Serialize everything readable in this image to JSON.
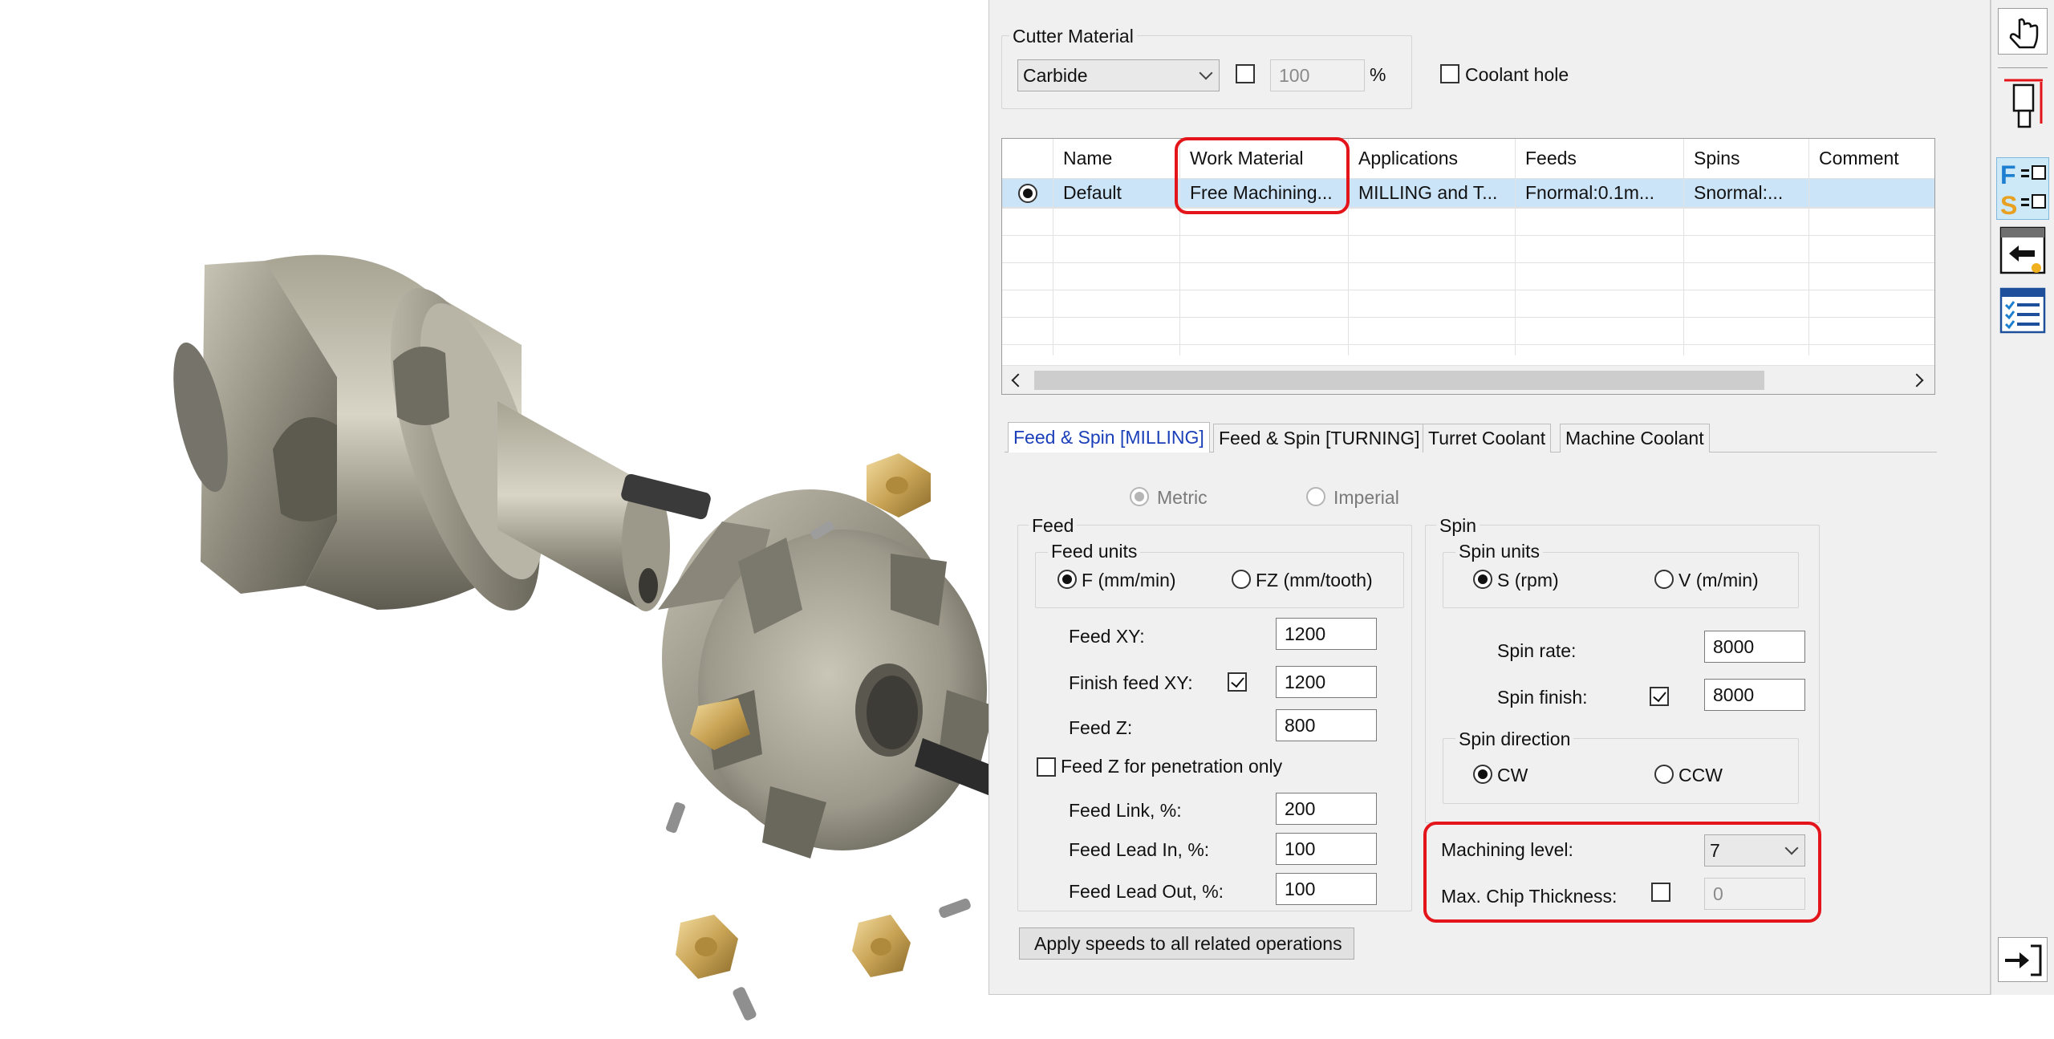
{
  "cutter_material": {
    "group_label": "Cutter Material",
    "material": "Carbide",
    "percent_value": "100",
    "percent_unit": "%",
    "coolant_hole_label": "Coolant hole"
  },
  "table": {
    "columns": [
      "Name",
      "Work Material",
      "Applications",
      "Feeds",
      "Spins",
      "Comment"
    ],
    "rows": [
      {
        "name": "Default",
        "work_material": "Free Machining...",
        "applications": "MILLING and T...",
        "feeds": "Fnormal:0.1m...",
        "spins": "Snormal:...",
        "comment": ""
      }
    ]
  },
  "tabs": [
    "Feed & Spin [MILLING]",
    "Feed & Spin [TURNING]",
    "Turret Coolant",
    "Machine Coolant"
  ],
  "units": {
    "metric": "Metric",
    "imperial": "Imperial"
  },
  "feed": {
    "group_label": "Feed",
    "units_label": "Feed units",
    "unit_f": "F (mm/min)",
    "unit_fz": "FZ (mm/tooth)",
    "feed_xy_label": "Feed XY:",
    "feed_xy": "1200",
    "finish_feed_xy_label": "Finish feed XY:",
    "finish_feed_xy": "1200",
    "feed_z_label": "Feed Z:",
    "feed_z": "800",
    "feed_z_penetration_label": "Feed Z for penetration only",
    "feed_link_label": "Feed Link, %:",
    "feed_link": "200",
    "feed_lead_in_label": "Feed Lead In, %:",
    "feed_lead_in": "100",
    "feed_lead_out_label": "Feed Lead Out, %:",
    "feed_lead_out": "100"
  },
  "spin": {
    "group_label": "Spin",
    "units_label": "Spin units",
    "unit_s": "S (rpm)",
    "unit_v": "V (m/min)",
    "spin_rate_label": "Spin rate:",
    "spin_rate": "8000",
    "spin_finish_label": "Spin finish:",
    "spin_finish": "8000",
    "direction_label": "Spin direction",
    "cw": "CW",
    "ccw": "CCW"
  },
  "machining": {
    "level_label": "Machining level:",
    "level": "7",
    "chip_thickness_label": "Max. Chip Thickness:",
    "chip_thickness": "0"
  },
  "apply_button": "Apply speeds to all related operations",
  "toolbar_icons": [
    "hand-pointer-icon",
    "tool-dimension-icon",
    "feed-spin-icon",
    "tool-holder-icon",
    "checklist-icon",
    "exit-arrow-icon"
  ],
  "colors": {
    "highlight": "#e3151a",
    "selection": "#cce4f7",
    "active_tab_text": "#1a3fb8"
  }
}
